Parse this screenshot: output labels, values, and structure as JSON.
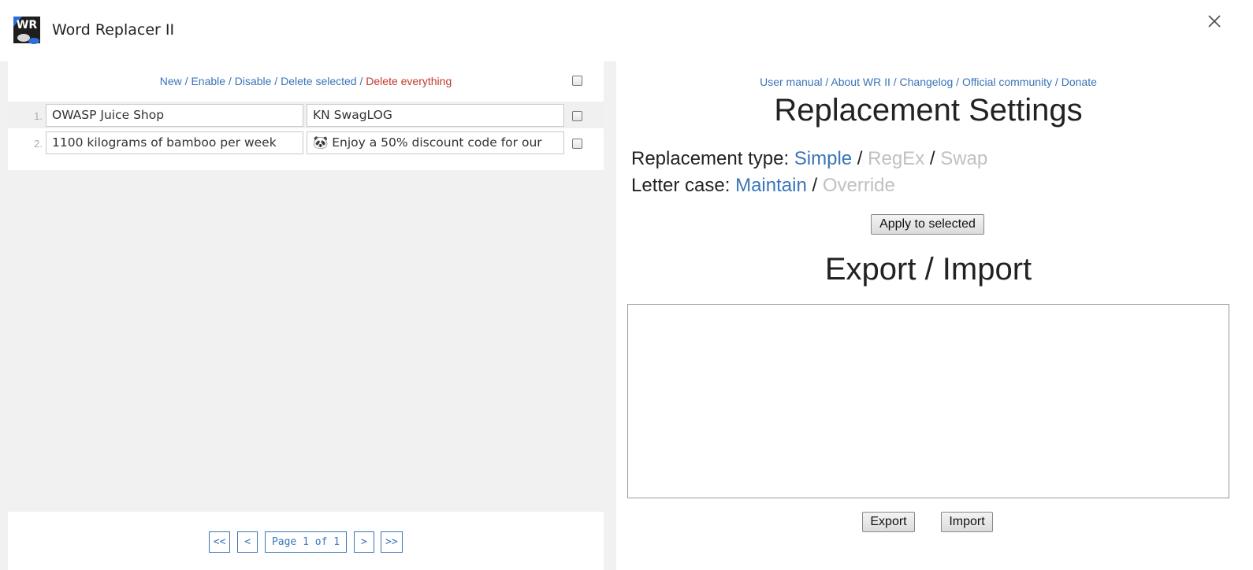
{
  "window": {
    "title": "Word Replacer II",
    "logo_text": "WR"
  },
  "toolbar": {
    "new": "New",
    "enable": "Enable",
    "disable": "Disable",
    "delete_selected": "Delete selected",
    "delete_everything": "Delete everything",
    "separator": " / "
  },
  "rules": [
    {
      "num": "1.",
      "find": "OWASP Juice Shop",
      "replace": "KN SwagLOG"
    },
    {
      "num": "2.",
      "find": "1100 kilograms of bamboo per week",
      "replace": "🐼 Enjoy a 50% discount code for our"
    }
  ],
  "pager": {
    "first": "<<",
    "prev": "<",
    "page": "Page 1 of 1",
    "next": ">",
    "last": ">>"
  },
  "links": {
    "user_manual": "User manual",
    "about": "About WR II",
    "changelog": "Changelog",
    "community": "Official community",
    "donate": "Donate",
    "separator": " / "
  },
  "settings": {
    "heading": "Replacement Settings",
    "type_label": "Replacement type: ",
    "type_simple": "Simple",
    "type_regex": "RegEx",
    "type_swap": "Swap",
    "case_label": "Letter case: ",
    "case_maintain": "Maintain",
    "case_override": "Override",
    "separator": " / ",
    "apply_button": "Apply to selected"
  },
  "export_import": {
    "heading": "Export / Import",
    "textarea_value": "",
    "export_button": "Export",
    "import_button": "Import"
  },
  "colors": {
    "link": "#3a74b8",
    "danger": "#c0392b",
    "inactive": "#c0c0c0"
  }
}
